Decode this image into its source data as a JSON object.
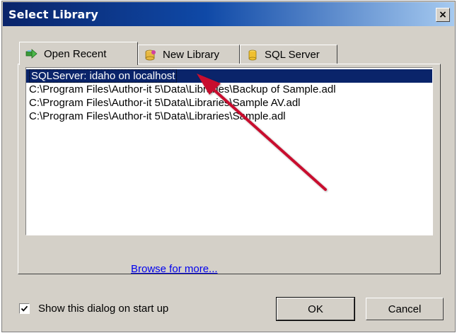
{
  "window": {
    "title": "Select Library",
    "close_glyph": "×"
  },
  "tabs": [
    {
      "label": "Open Recent",
      "icon": "green-arrow-icon",
      "active": true
    },
    {
      "label": "New Library",
      "icon": "database-new-icon",
      "active": false
    },
    {
      "label": "SQL Server",
      "icon": "database-cylinder-icon",
      "active": false
    }
  ],
  "recent_list": {
    "items": [
      {
        "label": "SQLServer: idaho on localhost",
        "selected": true
      },
      {
        "label": "C:\\Program Files\\Author-it 5\\Data\\Libraries\\Backup of Sample.adl",
        "selected": false
      },
      {
        "label": "C:\\Program Files\\Author-it 5\\Data\\Libraries\\Sample AV.adl",
        "selected": false
      },
      {
        "label": "C:\\Program Files\\Author-it 5\\Data\\Libraries\\Sample.adl",
        "selected": false
      }
    ]
  },
  "browse_link": "Browse for more...",
  "startup_checkbox": {
    "label": "Show this dialog on start up",
    "checked": true
  },
  "buttons": {
    "ok_label": "OK",
    "cancel_label": "Cancel"
  },
  "annotation": {
    "icon": "red-arrow-annotation",
    "color": "#c8102e"
  },
  "colors": {
    "dialog_bg": "#d4d0c8",
    "selection_bg": "#0a246a",
    "title_gradient_start": "#0a246a",
    "link": "#0000ee"
  }
}
